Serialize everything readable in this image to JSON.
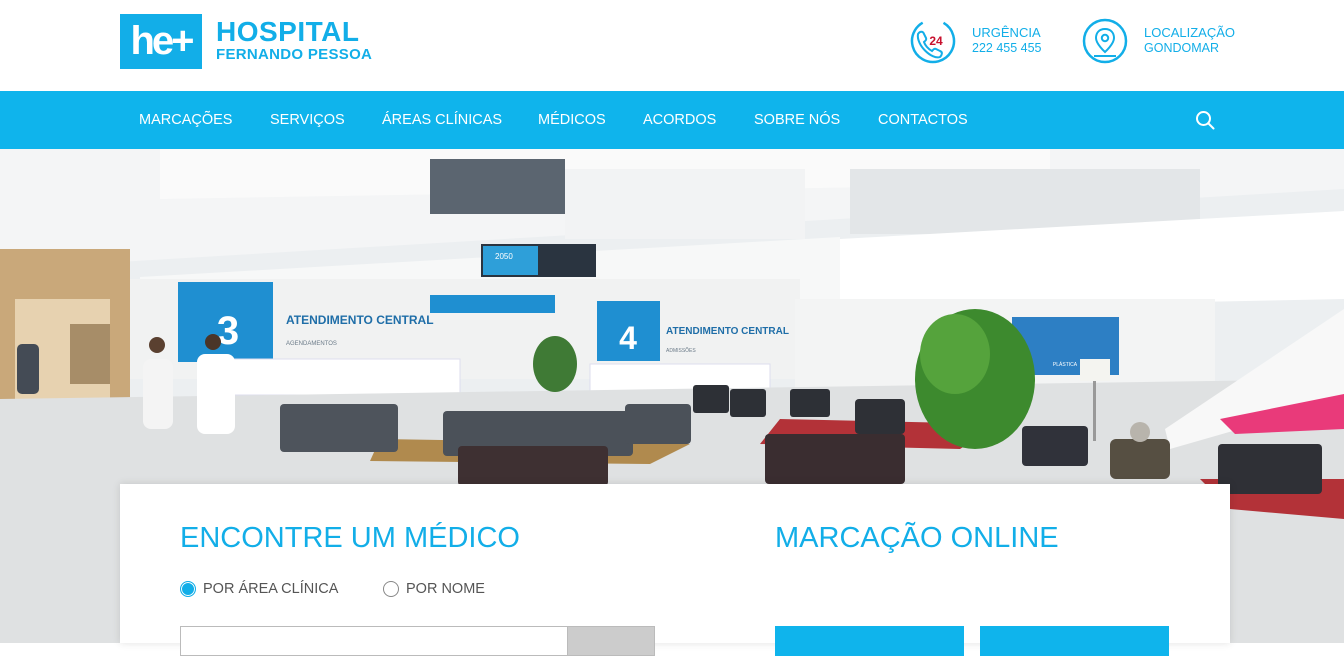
{
  "brand": {
    "mark": "he+",
    "line1": "HOSPITAL",
    "line2": "FERNANDO PESSOA",
    "color": "#12aee8"
  },
  "header": {
    "urgencia": {
      "icon": "phone-24-icon",
      "badge": "24",
      "label": "URGÊNCIA",
      "value": "222 455 455"
    },
    "localizacao": {
      "icon": "location-pin-icon",
      "label": "LOCALIZAÇÃO",
      "value": "GONDOMAR"
    }
  },
  "nav": {
    "items": [
      "MARCAÇÕES",
      "SERVIÇOS",
      "ÁREAS CLÍNICAS",
      "MÉDICOS",
      "ACORDOS",
      "SOBRE NÓS",
      "CONTACTOS"
    ],
    "search_icon": "search-icon",
    "color": "#0fb4ec"
  },
  "hero": {
    "sign_3": "3",
    "sign_3_text": "ATENDIMENTO CENTRAL",
    "sign_3_sub": "AGENDAMENTOS",
    "sign_4": "4",
    "sign_4_text": "ATENDIMENTO CENTRAL",
    "sign_4_sub": "ADMISSÕES",
    "screen_text": "2050",
    "right_screen_text": "PLÁSTICA"
  },
  "finder": {
    "title": "ENCONTRE UM MÉDICO",
    "options": [
      {
        "label": "POR ÁREA CLÍNICA",
        "selected": true
      },
      {
        "label": "POR NOME",
        "selected": false
      }
    ]
  },
  "booking": {
    "title": "MARCAÇÃO ONLINE"
  }
}
